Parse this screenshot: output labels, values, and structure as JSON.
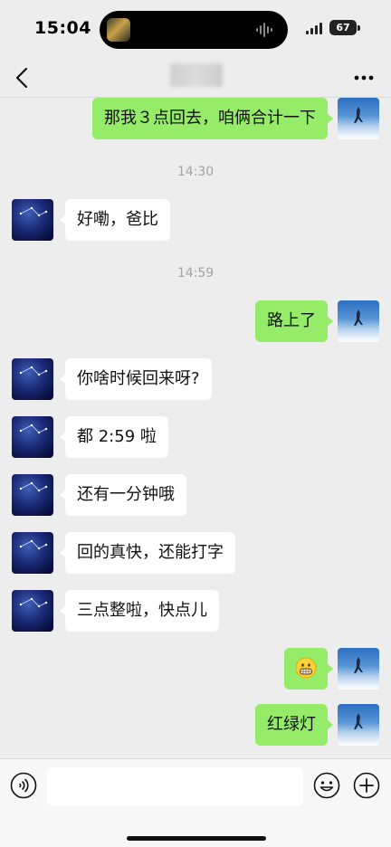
{
  "status_bar": {
    "time": "15:04",
    "battery": "67"
  },
  "nav": {
    "back_icon": "chevron-left-icon",
    "title": "",
    "more_icon": "more-dots-icon"
  },
  "messages": [
    {
      "type": "message",
      "side": "right",
      "text": "那我３点回去，咱俩合计一下"
    },
    {
      "type": "time",
      "text": "14:30"
    },
    {
      "type": "message",
      "side": "left",
      "text": "好嘞，爸比"
    },
    {
      "type": "time",
      "text": "14:59"
    },
    {
      "type": "message",
      "side": "right",
      "text": "路上了"
    },
    {
      "type": "message",
      "side": "left",
      "text": "你啥时候回来呀?"
    },
    {
      "type": "message",
      "side": "left",
      "text": "都 2:59 啦"
    },
    {
      "type": "message",
      "side": "left",
      "text": "还有一分钟哦"
    },
    {
      "type": "message",
      "side": "left",
      "text": "回的真快，还能打字"
    },
    {
      "type": "message",
      "side": "left",
      "text": "三点整啦，快点儿"
    },
    {
      "type": "message",
      "side": "right",
      "emoji": "grinning-face-icon"
    },
    {
      "type": "message",
      "side": "right",
      "text": "红绿灯"
    }
  ],
  "input_bar": {
    "voice_icon": "voice-icon",
    "input_value": "",
    "input_placeholder": "",
    "emoji_icon": "smiley-icon",
    "add_icon": "plus-circle-icon"
  },
  "colors": {
    "background": "#ededed",
    "sent_bubble": "#95ec69",
    "received_bubble": "#ffffff",
    "timestamp_text": "#a3a3a3"
  }
}
